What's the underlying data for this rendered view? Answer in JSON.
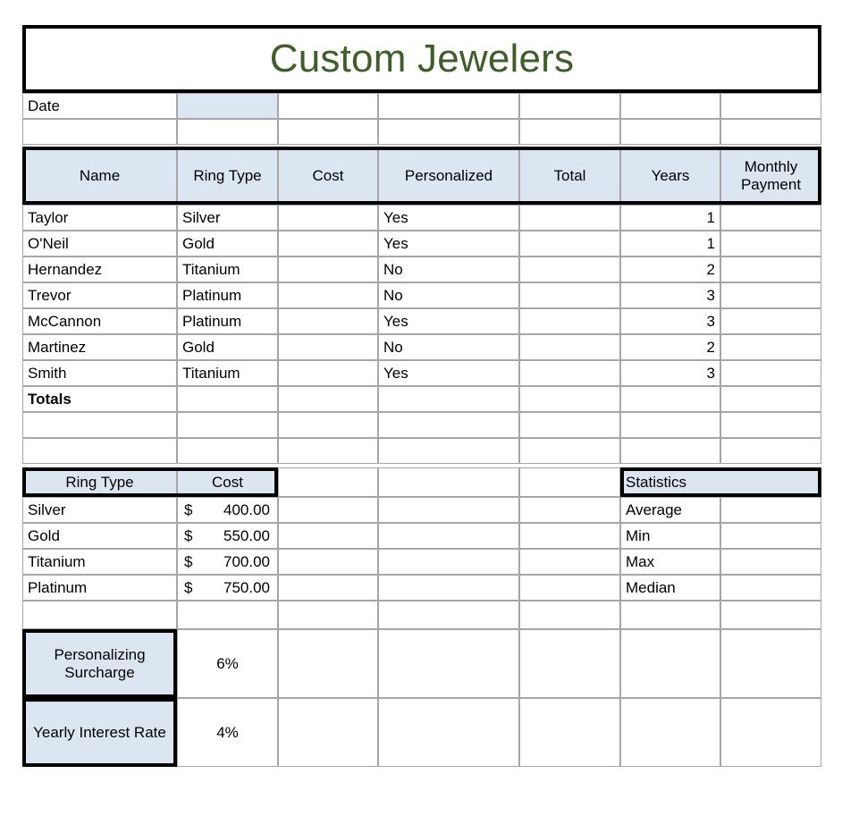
{
  "title": "Custom Jewelers",
  "title_color": "#3e5e28",
  "accent_fill": "#dce6f1",
  "gridline_color": "#a6a6a6",
  "date_row": {
    "label": "Date",
    "value": ""
  },
  "main_table": {
    "headers": [
      "Name",
      "Ring Type",
      "Cost",
      "Personalized",
      "Total",
      "Years",
      "Monthly Payment"
    ],
    "rows": [
      {
        "name": "Taylor",
        "ring_type": "Silver",
        "cost": "",
        "personalized": "Yes",
        "total": "",
        "years": "1",
        "monthly_payment": ""
      },
      {
        "name": "O'Neil",
        "ring_type": "Gold",
        "cost": "",
        "personalized": "Yes",
        "total": "",
        "years": "1",
        "monthly_payment": ""
      },
      {
        "name": "Hernandez",
        "ring_type": "Titanium",
        "cost": "",
        "personalized": "No",
        "total": "",
        "years": "2",
        "monthly_payment": ""
      },
      {
        "name": "Trevor",
        "ring_type": "Platinum",
        "cost": "",
        "personalized": "No",
        "total": "",
        "years": "3",
        "monthly_payment": ""
      },
      {
        "name": "McCannon",
        "ring_type": "Platinum",
        "cost": "",
        "personalized": "Yes",
        "total": "",
        "years": "3",
        "monthly_payment": ""
      },
      {
        "name": "Martinez",
        "ring_type": "Gold",
        "cost": "",
        "personalized": "No",
        "total": "",
        "years": "2",
        "monthly_payment": ""
      },
      {
        "name": "Smith",
        "ring_type": "Titanium",
        "cost": "",
        "personalized": "Yes",
        "total": "",
        "years": "3",
        "monthly_payment": ""
      }
    ],
    "totals_label": "Totals"
  },
  "price_table": {
    "headers": [
      "Ring Type",
      "Cost"
    ],
    "rows": [
      {
        "ring_type": "Silver",
        "symbol": "$",
        "amount": "400.00"
      },
      {
        "ring_type": "Gold",
        "symbol": "$",
        "amount": "550.00"
      },
      {
        "ring_type": "Titanium",
        "symbol": "$",
        "amount": "700.00"
      },
      {
        "ring_type": "Platinum",
        "symbol": "$",
        "amount": "750.00"
      }
    ]
  },
  "statistics": {
    "header": "Statistics",
    "rows": [
      {
        "label": "Average",
        "value": ""
      },
      {
        "label": "Min",
        "value": ""
      },
      {
        "label": "Max",
        "value": ""
      },
      {
        "label": "Median",
        "value": ""
      }
    ]
  },
  "parameters": [
    {
      "label": "Personalizing Surcharge",
      "value": "6%"
    },
    {
      "label": "Yearly Interest Rate",
      "value": "4%"
    }
  ]
}
